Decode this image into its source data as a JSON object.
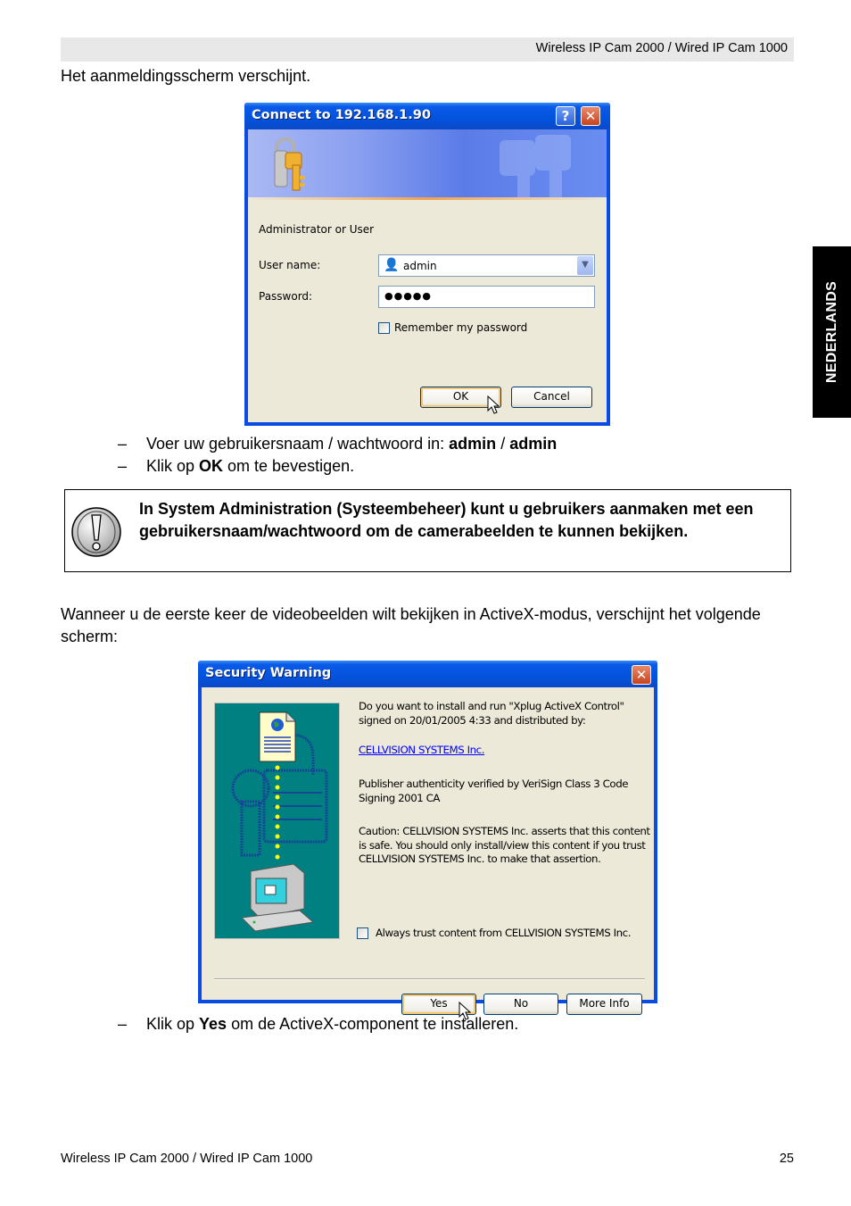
{
  "header": {
    "title": "Wireless IP Cam 2000 / Wired IP Cam 1000"
  },
  "side_tab": {
    "label": "NEDERLANDS"
  },
  "intro": "Het aanmeldingsscherm verschijnt.",
  "login_dialog": {
    "title": "Connect to 192.168.1.90",
    "help_icon": "question-mark-icon",
    "close_icon": "close-x-icon",
    "banner_icon": "keys-icon",
    "realm": "Administrator or User",
    "username_label": "User name:",
    "username_value": "admin",
    "user_icon": "user-avatar-icon",
    "password_label": "Password:",
    "password_value": "●●●●●",
    "remember_label": "Remember my password",
    "remember_checked": false,
    "ok_label": "OK",
    "cancel_label": "Cancel"
  },
  "bullets1": [
    {
      "dash": "–",
      "prefix": "Voer uw gebruikersnaam / wachtwoord in: ",
      "bold1": "admin",
      "mid": " / ",
      "bold2": "admin"
    },
    {
      "dash": "–",
      "prefix": "Klik op ",
      "bold1": "OK",
      "suffix": " om te bevestigen."
    }
  ],
  "note": {
    "icon": "exclamation-icon",
    "text": "In System Administration (Systeembeheer) kunt u gebruikers aanmaken met een gebruikersnaam/wachtwoord om de camerabeelden te kunnen bekijken."
  },
  "paragraph": "Wanneer u de eerste keer de videobeelden wilt bekijken in ActiveX-modus, verschijnt het volgende scherm:",
  "security_dialog": {
    "title": "Security Warning",
    "close_icon": "close-x-icon",
    "question": "Do you want to install and run \"Xplug ActiveX Control\" signed on 20/01/2005 4:33 and distributed by:",
    "publisher_link": "CELLVISION SYSTEMS Inc.",
    "verified": "Publisher authenticity verified by VeriSign Class 3 Code Signing 2001 CA",
    "caution": "Caution: CELLVISION SYSTEMS Inc. asserts that this content is safe.  You should only install/view this content if you trust CELLVISION SYSTEMS Inc. to make that assertion.",
    "always_trust_label": "Always trust content from CELLVISION SYSTEMS Inc.",
    "always_trust_checked": false,
    "yes_label": "Yes",
    "no_label": "No",
    "more_info_label": "More Info"
  },
  "bullets2": [
    {
      "dash": "–",
      "prefix": "Klik op ",
      "bold1": "Yes",
      "suffix": " om de ActiveX-component te installeren."
    }
  ],
  "footer": {
    "left": "Wireless IP Cam 2000 / Wired IP Cam 1000",
    "page_number": "25"
  }
}
